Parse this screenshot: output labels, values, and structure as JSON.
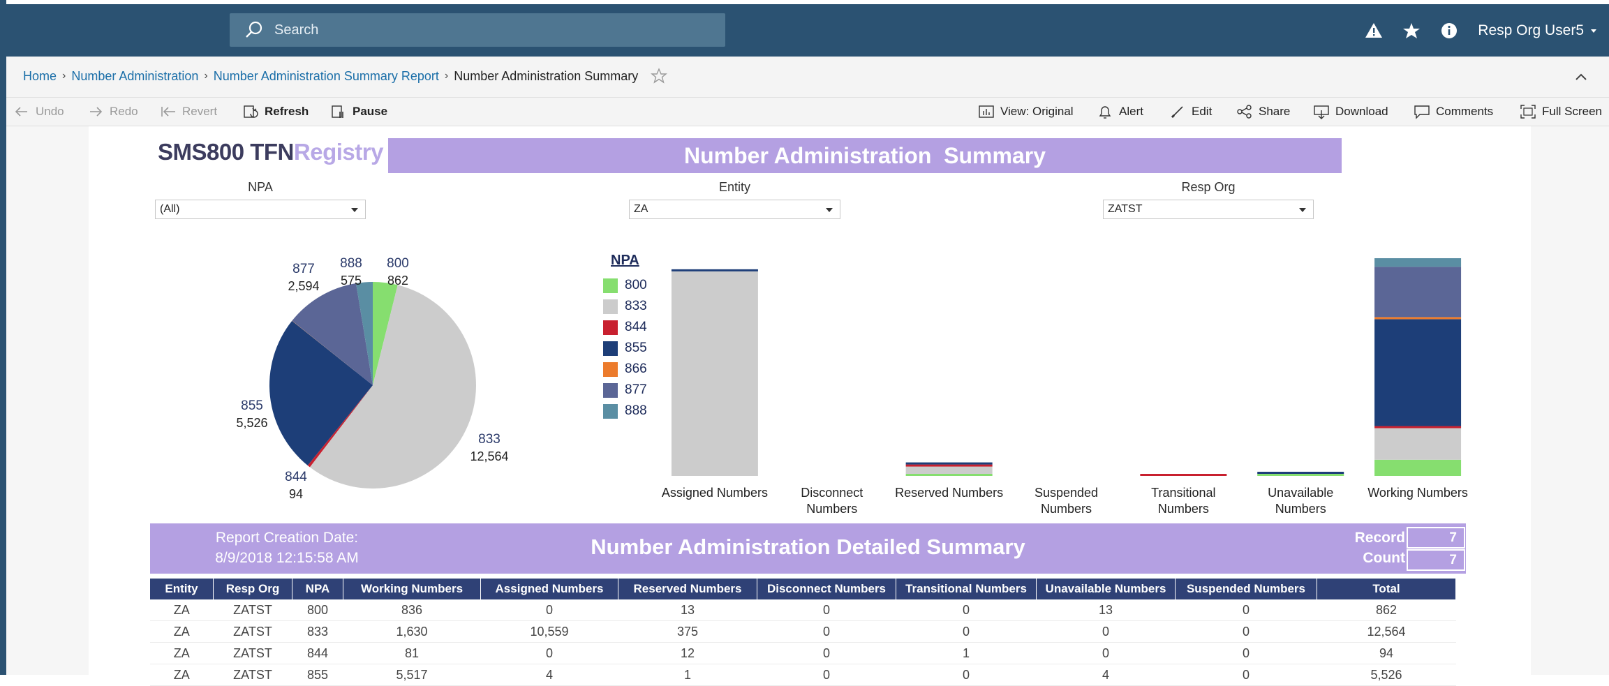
{
  "topbar": {
    "search_placeholder": "Search",
    "user_name": "Resp Org User5",
    "colors": {
      "bar": "#2b5272",
      "search": "#4f7691"
    }
  },
  "breadcrumb": {
    "items": [
      "Home",
      "Number Administration",
      "Number Administration Summary Report"
    ],
    "current": "Number Administration Summary"
  },
  "toolbar": {
    "undo": "Undo",
    "redo": "Redo",
    "revert": "Revert",
    "refresh": "Refresh",
    "pause": "Pause",
    "view": "View: Original",
    "alert": "Alert",
    "edit": "Edit",
    "share": "Share",
    "download": "Download",
    "comments": "Comments",
    "fullscreen": "Full Screen"
  },
  "dashboard": {
    "logo_dark": "SMS800 TFN",
    "logo_light": "Registry",
    "title": "Number Administration  Summary",
    "filters": {
      "npa": {
        "label": "NPA",
        "value": "(All)"
      },
      "entity": {
        "label": "Entity",
        "value": "ZA"
      },
      "resp_org": {
        "label": "Resp Org",
        "value": "ZATST"
      }
    }
  },
  "pie_labels": [
    {
      "npa": "877",
      "value": "2,594"
    },
    {
      "npa": "888",
      "value": "575"
    },
    {
      "npa": "800",
      "value": "862"
    },
    {
      "npa": "855",
      "value": "5,526"
    },
    {
      "npa": "833",
      "value": "12,564"
    },
    {
      "npa": "844",
      "value": "94"
    }
  ],
  "legend": {
    "title": "NPA",
    "items": [
      {
        "label": "800",
        "color": "#86de6f"
      },
      {
        "label": "833",
        "color": "#cccccc"
      },
      {
        "label": "844",
        "color": "#c8202f"
      },
      {
        "label": "855",
        "color": "#1d3e78"
      },
      {
        "label": "866",
        "color": "#ec7b2c"
      },
      {
        "label": "877",
        "color": "#5b6696"
      },
      {
        "label": "888",
        "color": "#5a8ea3"
      }
    ]
  },
  "chart_data": [
    {
      "type": "pie",
      "categories": [
        "800",
        "833",
        "844",
        "855",
        "866",
        "877",
        "888"
      ],
      "values": [
        862,
        12564,
        94,
        5526,
        6,
        2594,
        575
      ],
      "colors": [
        "#86de6f",
        "#cccccc",
        "#c8202f",
        "#1d3e78",
        "#ec7b2c",
        "#5b6696",
        "#5a8ea3"
      ]
    },
    {
      "type": "bar",
      "stacked": true,
      "categories": [
        "Assigned Numbers",
        "Disconnect Numbers",
        "Reserved Numbers",
        "Suspended Numbers",
        "Transitional Numbers",
        "Unavailable Numbers",
        "Working Numbers"
      ],
      "series": [
        {
          "name": "800",
          "values": [
            0,
            0,
            13,
            0,
            0,
            13,
            836
          ],
          "color": "#86de6f"
        },
        {
          "name": "833",
          "values": [
            10559,
            0,
            375,
            0,
            0,
            0,
            1630
          ],
          "color": "#cccccc"
        },
        {
          "name": "844",
          "values": [
            0,
            0,
            12,
            0,
            1,
            0,
            81
          ],
          "color": "#c8202f"
        },
        {
          "name": "855",
          "values": [
            4,
            0,
            1,
            0,
            0,
            4,
            5517
          ],
          "color": "#1d3e78"
        },
        {
          "name": "866",
          "values": [
            0,
            0,
            0,
            0,
            0,
            0,
            6
          ],
          "color": "#ec7b2c"
        },
        {
          "name": "877",
          "values": [
            0,
            0,
            0,
            0,
            0,
            0,
            2594
          ],
          "color": "#5b6696"
        },
        {
          "name": "888",
          "values": [
            0,
            0,
            0,
            0,
            0,
            0,
            575
          ],
          "color": "#5a8ea3"
        }
      ]
    }
  ],
  "bar_category_labels": [
    [
      "Assigned Numbers"
    ],
    [
      "Disconnect",
      "Numbers"
    ],
    [
      "Reserved Numbers"
    ],
    [
      "Suspended",
      "Numbers"
    ],
    [
      "Transitional",
      "Numbers"
    ],
    [
      "Unavailable",
      "Numbers"
    ],
    [
      "Working Numbers"
    ]
  ],
  "detail": {
    "report_label": "Report Creation Date:",
    "report_date": "8/9/2018 12:15:58 AM",
    "title": "Number Administration Detailed Summary",
    "record_label_1": "Record",
    "record_label_2": "Count",
    "record_count_1": "7",
    "record_count_2": "7",
    "columns": [
      "Entity",
      "Resp Org",
      "NPA",
      "Working Numbers",
      "Assigned Numbers",
      "Reserved Numbers",
      "Disconnect Numbers",
      "Transitional Numbers",
      "Unavailable Numbers",
      "Suspended Numbers",
      "Total"
    ],
    "rows": [
      [
        "ZA",
        "ZATST",
        "800",
        "836",
        "0",
        "13",
        "0",
        "0",
        "13",
        "0",
        "862"
      ],
      [
        "ZA",
        "ZATST",
        "833",
        "1,630",
        "10,559",
        "375",
        "0",
        "0",
        "0",
        "0",
        "12,564"
      ],
      [
        "ZA",
        "ZATST",
        "844",
        "81",
        "0",
        "12",
        "0",
        "1",
        "0",
        "0",
        "94"
      ],
      [
        "ZA",
        "ZATST",
        "855",
        "5,517",
        "4",
        "1",
        "0",
        "0",
        "4",
        "0",
        "5,526"
      ]
    ]
  }
}
